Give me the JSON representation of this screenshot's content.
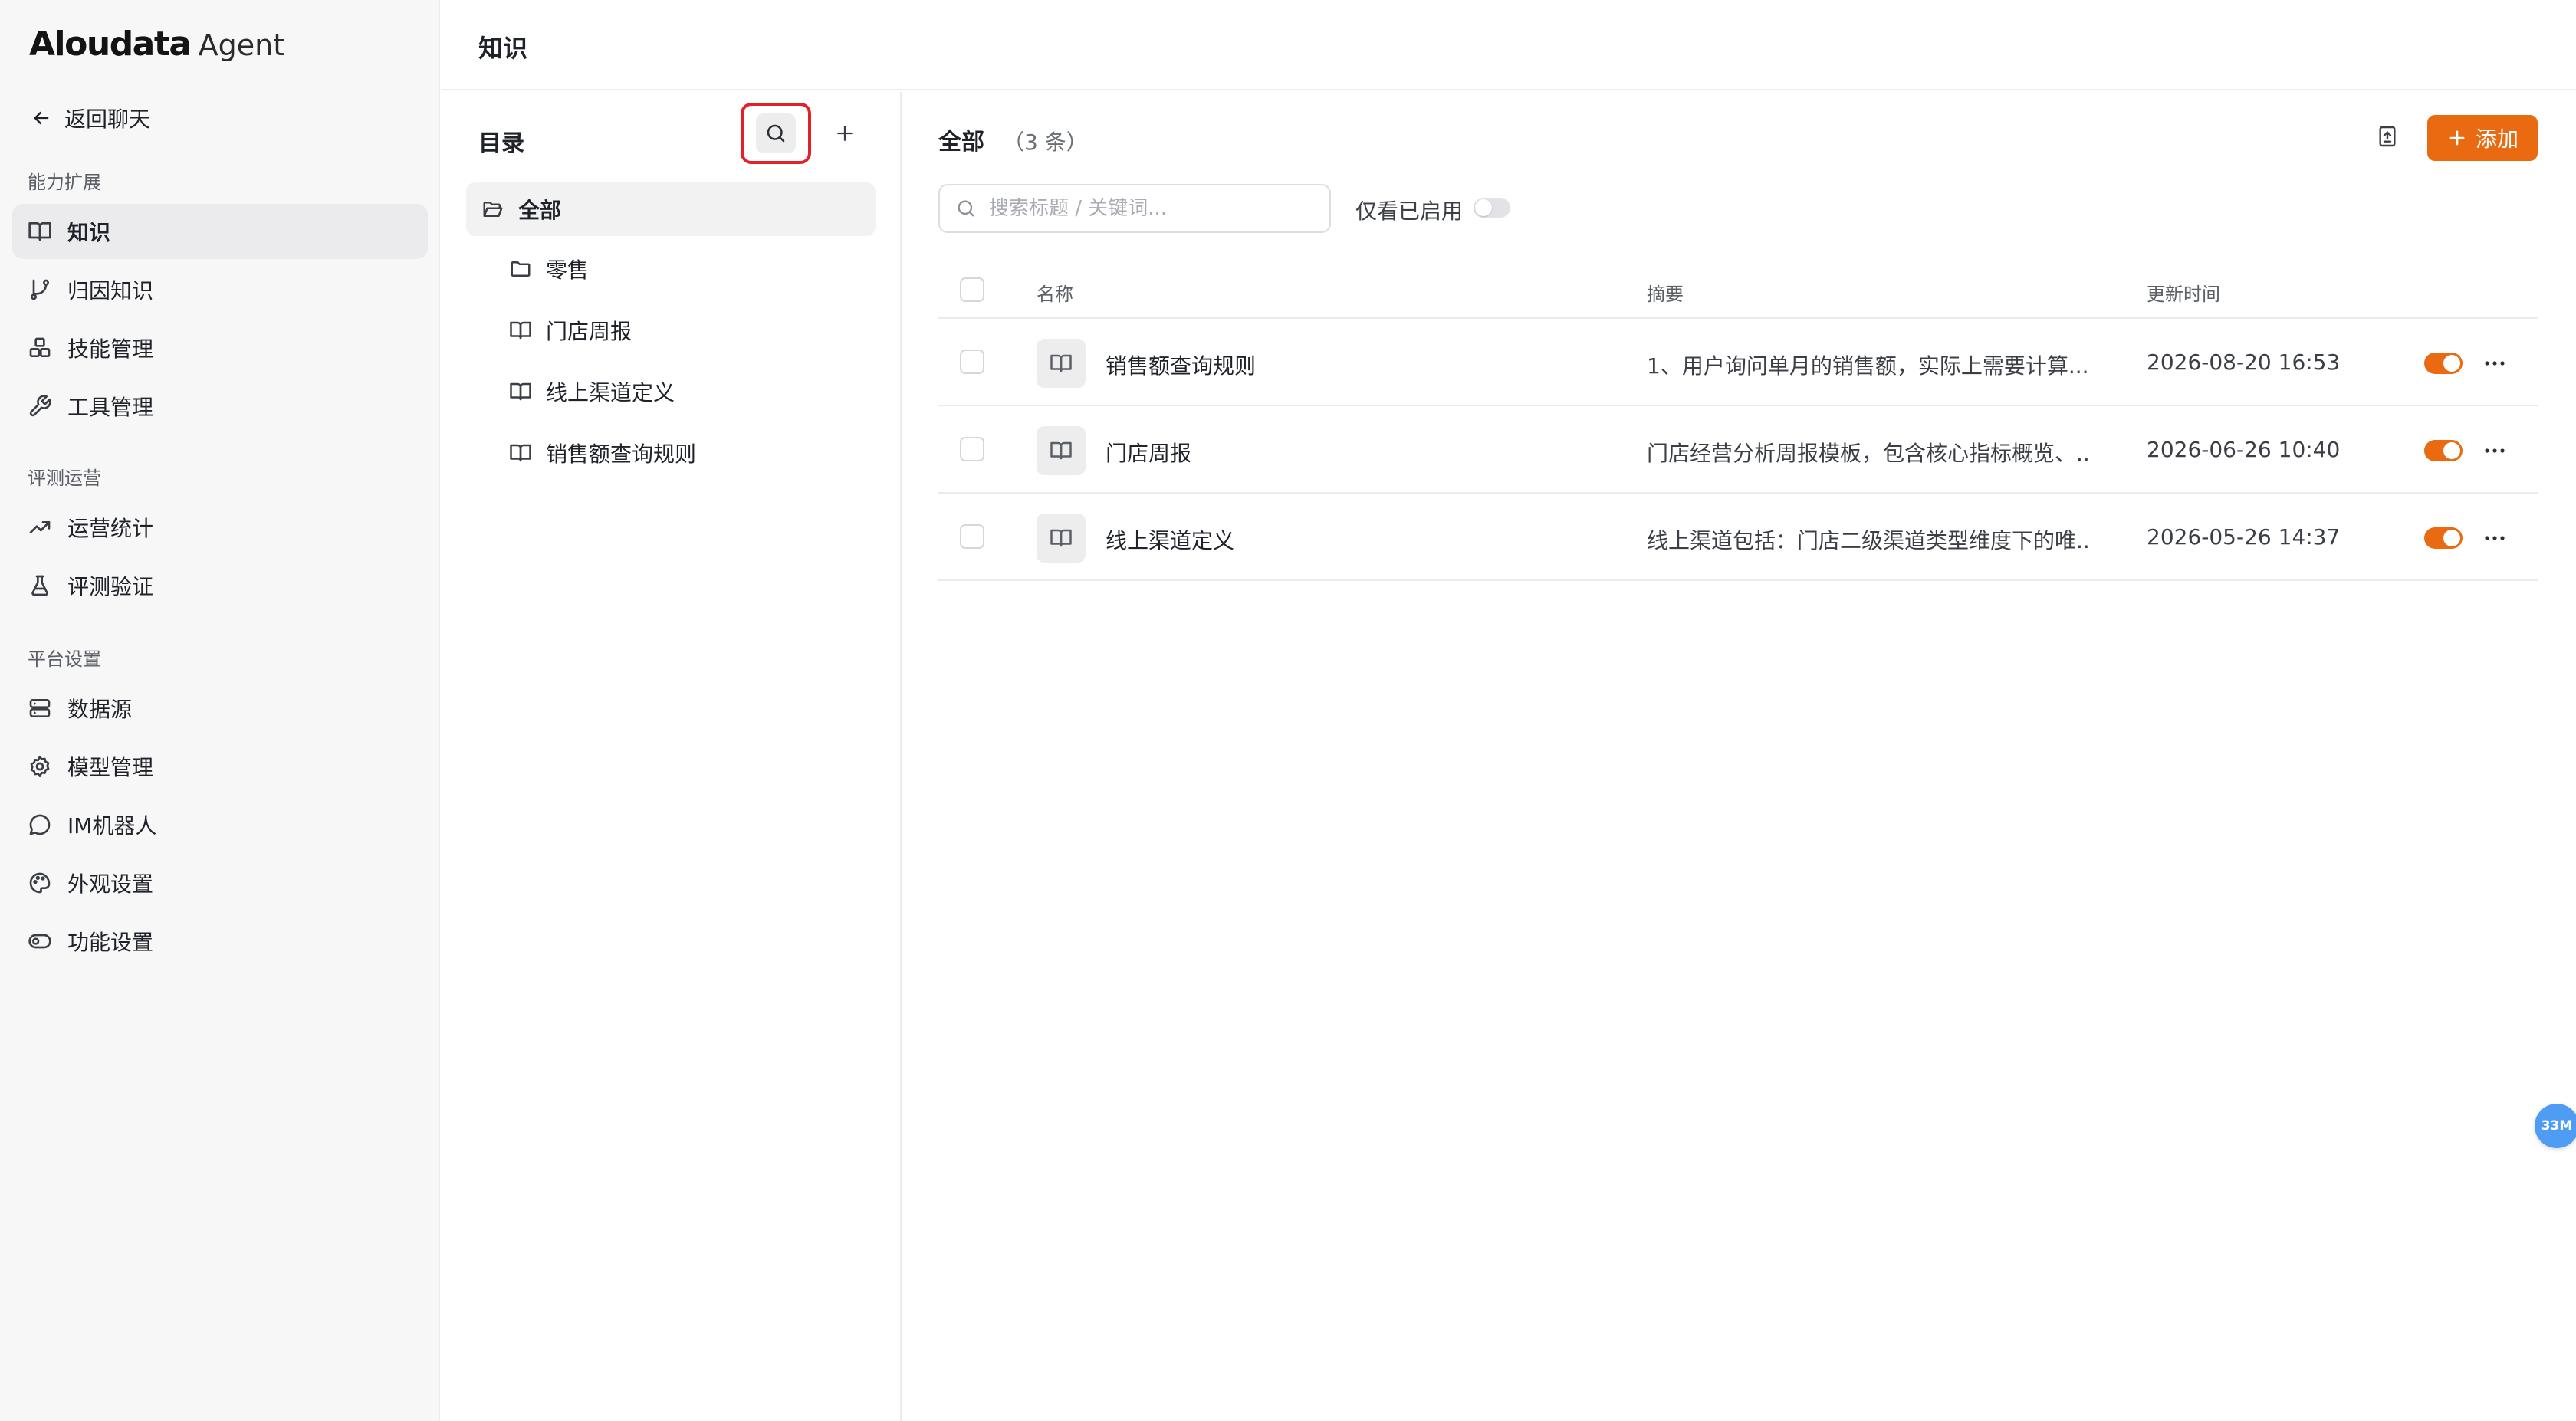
{
  "brand": {
    "name": "Aloudata",
    "product": "Agent"
  },
  "sidebar": {
    "back_label": "返回聊天",
    "sections": [
      {
        "label": "能力扩展",
        "items": [
          {
            "label": "知识",
            "icon": "book-open-icon",
            "active": true
          },
          {
            "label": "归因知识",
            "icon": "git-branch-icon"
          },
          {
            "label": "技能管理",
            "icon": "boxes-icon"
          },
          {
            "label": "工具管理",
            "icon": "wrench-icon"
          }
        ]
      },
      {
        "label": "评测运营",
        "items": [
          {
            "label": "运营统计",
            "icon": "trending-up-icon"
          },
          {
            "label": "评测验证",
            "icon": "flask-icon"
          }
        ]
      },
      {
        "label": "平台设置",
        "items": [
          {
            "label": "数据源",
            "icon": "server-icon"
          },
          {
            "label": "模型管理",
            "icon": "gear-icon"
          },
          {
            "label": "IM机器人",
            "icon": "chat-bubble-icon"
          },
          {
            "label": "外观设置",
            "icon": "palette-icon"
          },
          {
            "label": "功能设置",
            "icon": "toggle-icon"
          }
        ]
      }
    ]
  },
  "header": {
    "title": "知识"
  },
  "catalog": {
    "title": "目录",
    "items": [
      {
        "label": "全部",
        "icon": "folder-open-icon",
        "active": true
      },
      {
        "label": "零售",
        "icon": "folder-icon"
      },
      {
        "label": "门店周报",
        "icon": "book-open-icon"
      },
      {
        "label": "线上渠道定义",
        "icon": "book-open-icon"
      },
      {
        "label": "销售额查询规则",
        "icon": "book-open-icon"
      }
    ]
  },
  "main": {
    "title": "全部",
    "count": "（3 条）",
    "add_label": "添加",
    "search_placeholder": "搜索标题 / 关键词...",
    "filter_label": "仅看已启用",
    "filter_enabled": false,
    "columns": {
      "name": "名称",
      "summary": "摘要",
      "updated": "更新时间"
    },
    "rows": [
      {
        "name": "销售额查询规则",
        "summary": "1、用户询问单月的销售额，实际上需要计算...",
        "updated": "2026-08-20 16:53",
        "enabled": true
      },
      {
        "name": "门店周报",
        "summary": "门店经营分析周报模板，包含核心指标概览、...",
        "updated": "2026-06-26 10:40",
        "enabled": true
      },
      {
        "name": "线上渠道定义",
        "summary": "线上渠道包括：门店二级渠道类型维度下的唯...",
        "updated": "2026-05-26 14:37",
        "enabled": true
      }
    ]
  },
  "badge": {
    "label": "33M"
  },
  "colors": {
    "accent": "#e96a10",
    "highlight_border": "#e5202b",
    "badge": "#4f9cf5"
  }
}
